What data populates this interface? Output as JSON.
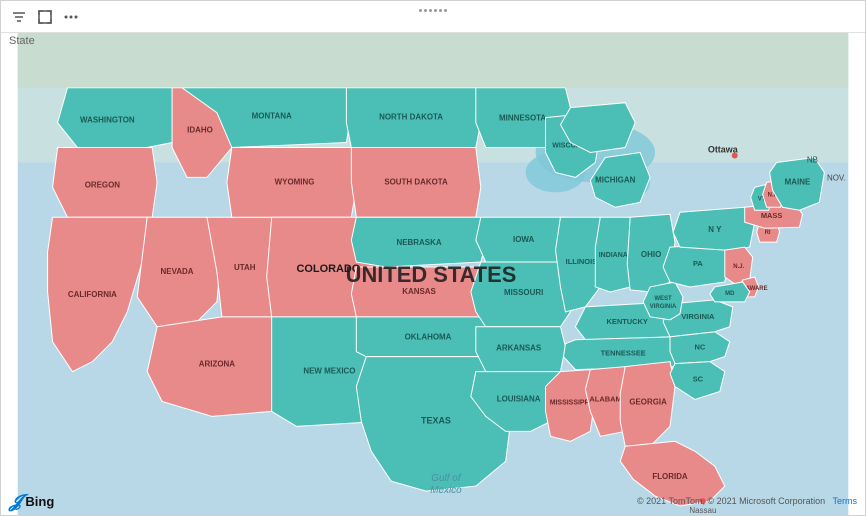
{
  "toolbar": {
    "drag_handle": "drag-handle",
    "filter_icon": "⊞",
    "expand_icon": "⤢",
    "more_icon": "⋯"
  },
  "state_label": "State",
  "map": {
    "title": "UNITED STATES",
    "gulf_label": "Gulf of\nMexico",
    "ottawa_label": "Ottawa",
    "nassau_label": "Nassau",
    "states": {
      "teal": [
        "WASHINGTON",
        "MONTANA",
        "NORTH DAKOTA",
        "MINNESOTA",
        "MICHIGAN",
        "WISCONSIN",
        "IOWA",
        "ILLINOIS",
        "INDIANA",
        "OHIO",
        "NEBRASKA",
        "MISSOURI",
        "KENTUCKY",
        "TENNESSEE",
        "ARKANSAS",
        "TEXAS",
        "LOUISIANA",
        "NC",
        "SC",
        "VIRGINIA",
        "WEST VIRGINIA",
        "PENNSYLVANIA",
        "NY",
        "NH",
        "VT",
        "MAINE"
      ],
      "salmon": [
        "OREGON",
        "IDAHO",
        "WYOMING",
        "SOUTH DAKOTA",
        "NEVADA",
        "UTAH",
        "COLORADO",
        "KANSAS",
        "ARIZONA",
        "NEW MEXICO",
        "OKLAHOMA",
        "CALIFORNIA",
        "MISSISSIPPI",
        "ALABAMA",
        "GEORGIA",
        "FLORIDA",
        "MASSACHUSETTS",
        "MD",
        "NJ",
        "DELAWARE",
        "RI"
      ]
    }
  },
  "bottom_bar": {
    "bing_label": "Bing",
    "copyright": "© 2021 TomTom, © 2021 Microsoft Corporation",
    "terms_label": "Terms"
  }
}
